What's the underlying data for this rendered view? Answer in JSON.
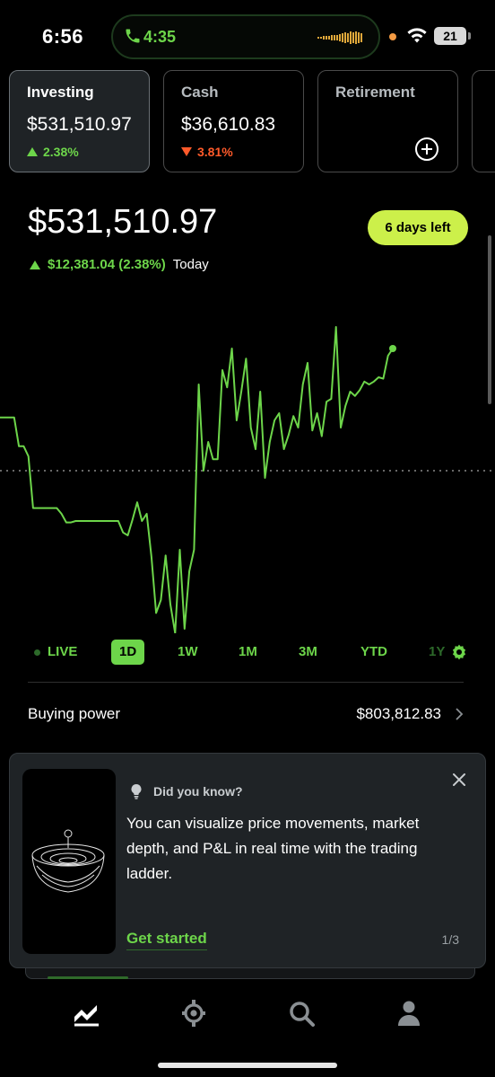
{
  "status_bar": {
    "time": "6:56",
    "island_time": "4:35",
    "battery": "21"
  },
  "accounts": [
    {
      "title": "Investing",
      "value": "$531,510.97",
      "change": "2.38%",
      "direction": "up",
      "selected": true
    },
    {
      "title": "Cash",
      "value": "$36,610.83",
      "change": "3.81%",
      "direction": "down",
      "selected": false
    },
    {
      "title": "Retirement",
      "value": "",
      "change": "",
      "action_icon": "add-icon",
      "selected": false
    }
  ],
  "portfolio": {
    "value": "$531,510.97",
    "change_amount": "$12,381.04 (2.38%)",
    "change_label": "Today",
    "badge": "6 days left"
  },
  "chart_data": {
    "type": "line",
    "color": "#6dd54a",
    "baseline_style": "dotted",
    "y_relative_to_baseline": [
      0.37,
      0.37,
      0.37,
      0.37,
      0.17,
      0.17,
      0.1,
      -0.26,
      -0.26,
      -0.26,
      -0.26,
      -0.26,
      -0.26,
      -0.3,
      -0.36,
      -0.36,
      -0.35,
      -0.35,
      -0.35,
      -0.35,
      -0.35,
      -0.35,
      -0.35,
      -0.35,
      -0.35,
      -0.35,
      -0.43,
      -0.45,
      -0.34,
      -0.22,
      -0.35,
      -0.3,
      -0.6,
      -0.99,
      -0.9,
      -0.59,
      -0.93,
      -1.13,
      -0.55,
      -1.1,
      -0.7,
      -0.55,
      0.6,
      0.0,
      0.2,
      0.08,
      0.08,
      0.7,
      0.58,
      0.85,
      0.35,
      0.55,
      0.78,
      0.3,
      0.15,
      0.55,
      -0.05,
      0.2,
      0.35,
      0.4,
      0.15,
      0.25,
      0.38,
      0.3,
      0.6,
      0.75,
      0.28,
      0.4,
      0.24,
      0.48,
      0.5,
      1.0,
      0.3,
      0.45,
      0.55,
      0.52,
      0.56,
      0.62,
      0.6,
      0.62,
      0.65,
      0.64,
      0.8,
      0.85
    ]
  },
  "ranges": {
    "live": "LIVE",
    "d1": "1D",
    "w1": "1W",
    "m1": "1M",
    "m3": "3M",
    "ytd": "YTD",
    "y1": "1Y",
    "active": "1D"
  },
  "buying_power": {
    "label": "Buying power",
    "value": "$803,812.83"
  },
  "info_card": {
    "kicker": "Did you know?",
    "text": "You can visualize price movements, market depth, and P&L in real time with the trading ladder.",
    "cta": "Get started",
    "page": "1/3"
  },
  "tab_bar": {
    "items": [
      "chart-icon",
      "crypto-icon",
      "search-icon",
      "account-icon"
    ],
    "active": "chart-icon"
  },
  "colors": {
    "accent": "#6dd54a",
    "negative": "#ff5a2a",
    "badge": "#ccf04a",
    "card_bg": "#1f2326"
  }
}
